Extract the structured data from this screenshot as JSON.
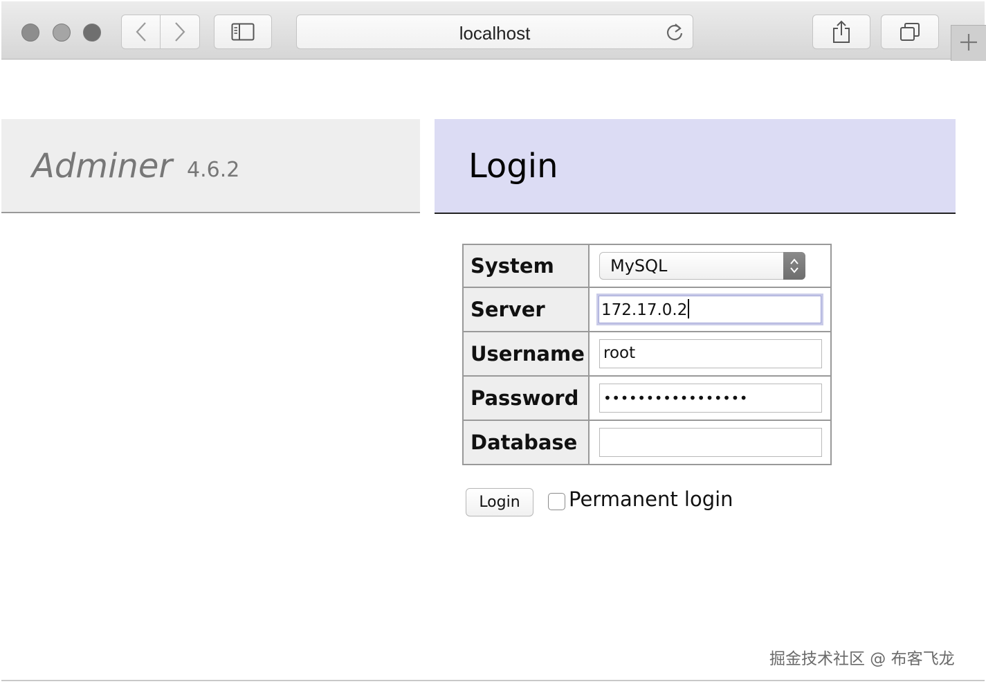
{
  "browser": {
    "url": "localhost",
    "icons": {
      "back": "chevron-left-icon",
      "forward": "chevron-right-icon",
      "sidebar": "sidebar-icon",
      "reload": "reload-icon",
      "share": "share-icon",
      "tabs": "tab-overview-icon",
      "new_tab": "plus-icon"
    }
  },
  "brand": {
    "name": "Adminer",
    "version": "4.6.2"
  },
  "heading": "Login",
  "form": {
    "rows": [
      {
        "label": "System",
        "type": "select",
        "value": "MySQL"
      },
      {
        "label": "Server",
        "type": "text",
        "value": "172.17.0.2",
        "focused": true
      },
      {
        "label": "Username",
        "type": "text",
        "value": "root"
      },
      {
        "label": "Password",
        "type": "password",
        "value": "•••••••••••••••••"
      },
      {
        "label": "Database",
        "type": "text",
        "value": ""
      }
    ],
    "submit_label": "Login",
    "permanent_label": "Permanent login",
    "permanent_checked": false
  },
  "watermark": "掘金技术社区 @ 布客飞龙",
  "colors": {
    "heading_bg": "#dcdcf4",
    "brand_bg": "#eeeeee",
    "label_bg": "#eeeeee",
    "border": "#999999"
  }
}
